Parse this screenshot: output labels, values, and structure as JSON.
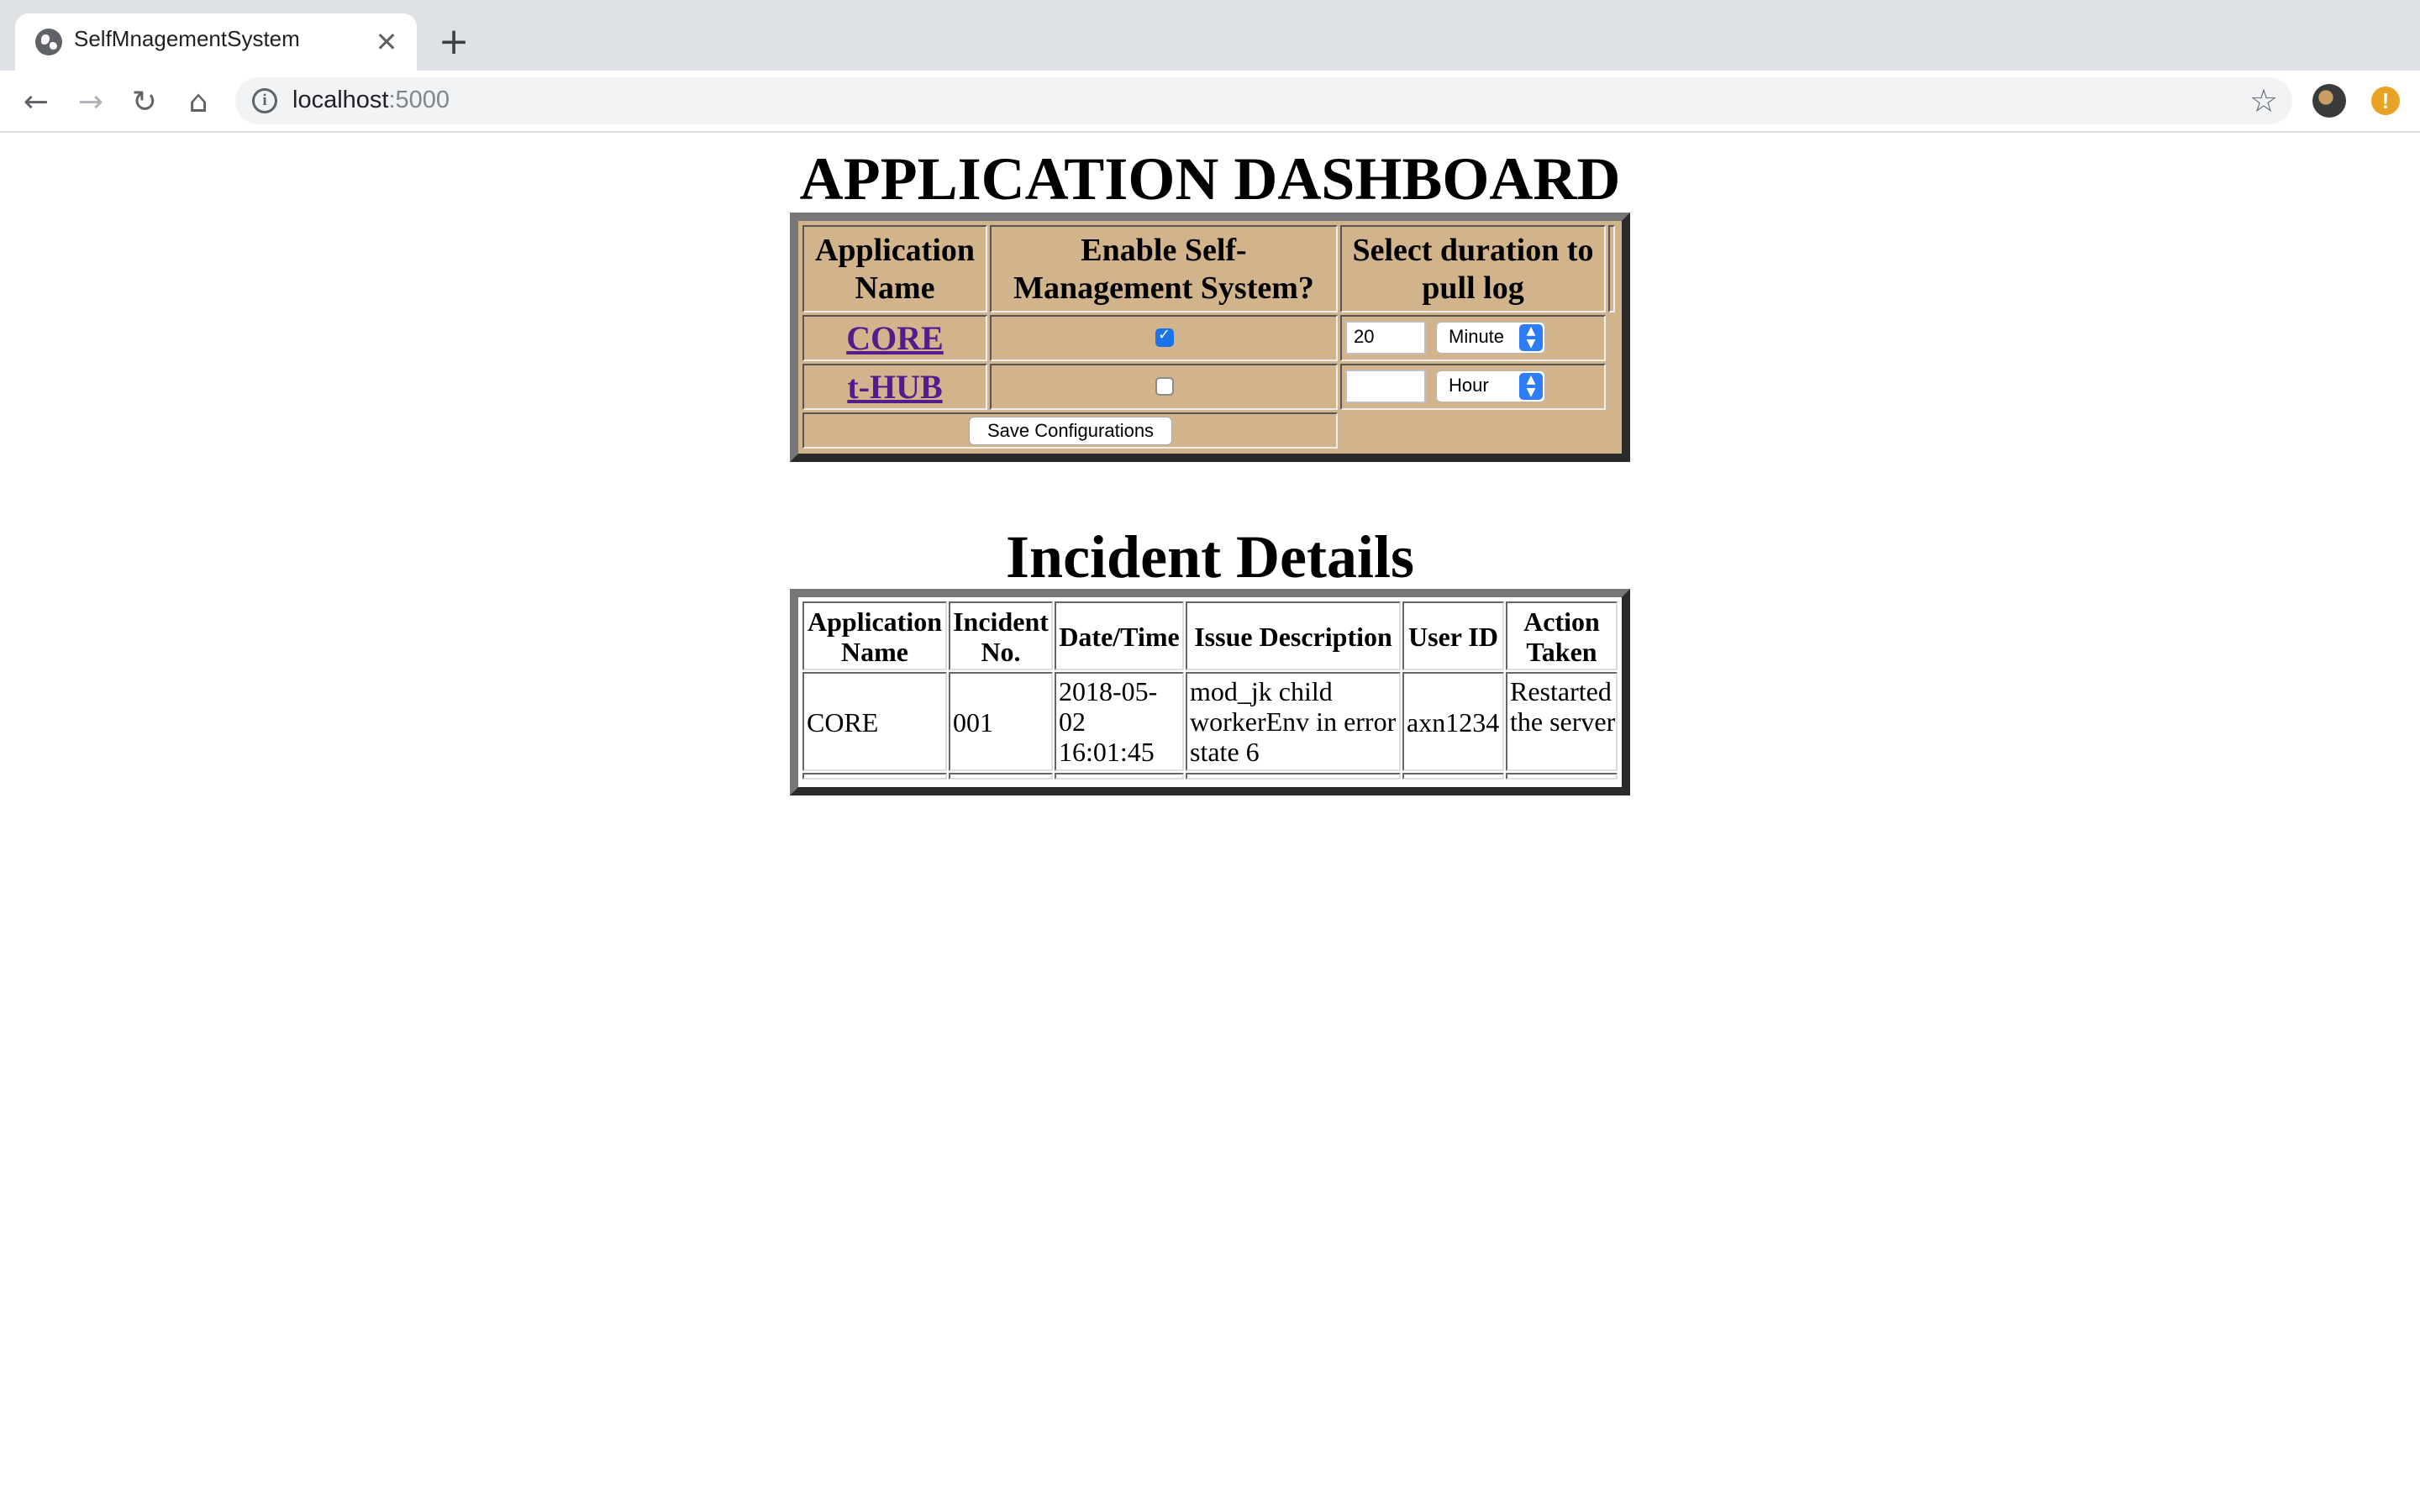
{
  "browser": {
    "tab_title": "SelfMnagementSystem",
    "url_host": "localhost",
    "url_port": ":5000"
  },
  "dashboard": {
    "title": "APPLICATION DASHBOARD",
    "headers": {
      "app_name": "Application Name",
      "enable": "Enable Self-Management System?",
      "duration": "Select duration to pull log"
    },
    "rows": [
      {
        "app": "CORE",
        "enabled": true,
        "duration_value": "20",
        "duration_unit": "Minute"
      },
      {
        "app": "t-HUB",
        "enabled": false,
        "duration_value": "",
        "duration_unit": "Hour"
      }
    ],
    "save_label": "Save Configurations"
  },
  "incidents": {
    "title": "Incident Details",
    "headers": [
      "Application Name",
      "Incident No.",
      "Date/Time",
      "Issue Description",
      "User ID",
      "Action Taken"
    ],
    "rows": [
      {
        "app": "CORE",
        "no": "001",
        "datetime": "2018-05-02 16:01:45",
        "issue": "mod_jk child workerEnv in error state 6",
        "user": "axn1234",
        "action": "Restarted the server"
      }
    ]
  },
  "colors": {
    "dashboard_bg": "#d2b48c",
    "link": "#551a8b",
    "checkbox_checked": "#1a73e8"
  }
}
